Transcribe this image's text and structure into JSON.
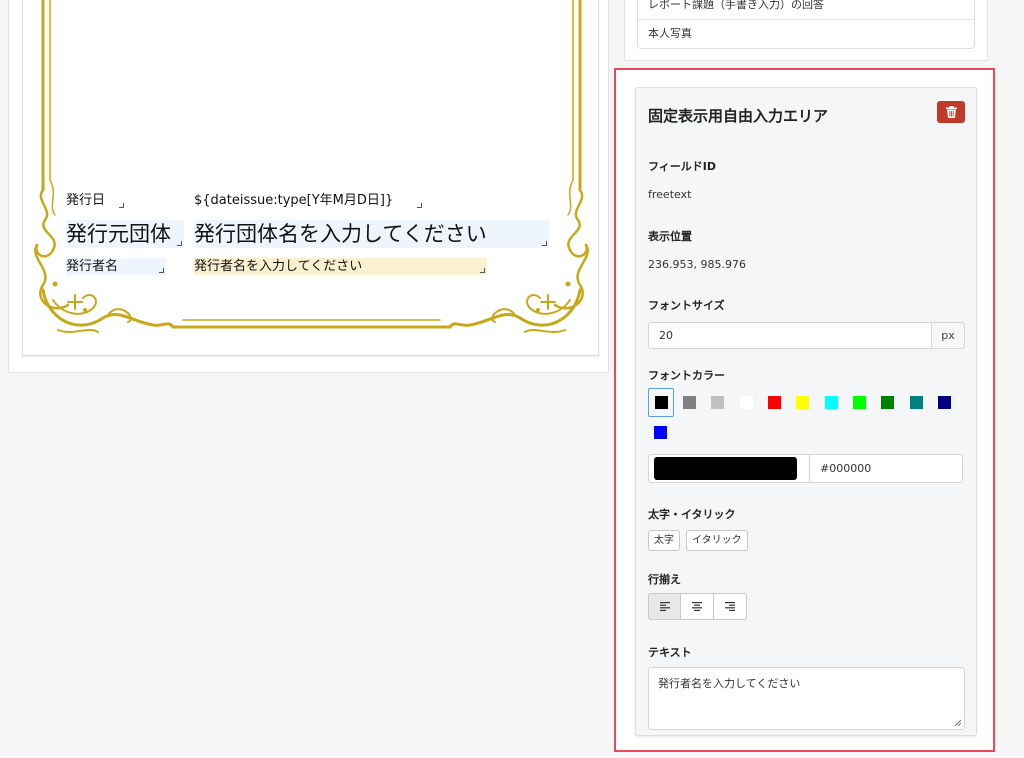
{
  "certificate": {
    "issue_date_label": "発行日",
    "issue_date_value": "${dateissue:type[Y年M月D日]}",
    "org_label": "発行元団体",
    "org_value": "発行団体名を入力してください",
    "issuer_label": "発行者名",
    "issuer_value": "発行者名を入力してください"
  },
  "field_list": {
    "items": [
      "レポート課題（手書き入力）の回答",
      "本人写真"
    ]
  },
  "panel": {
    "title": "固定表示用自由入力エリア",
    "field_id_label": "フィールドID",
    "field_id_value": "freetext",
    "position_label": "表示位置",
    "position_value": "236.953, 985.976",
    "font_size_label": "フォントサイズ",
    "font_size_value": "20",
    "font_size_unit": "px",
    "font_color_label": "フォントカラー",
    "palette": [
      "#000000",
      "#808080",
      "#c0c0c0",
      "#ffffff",
      "#ff0000",
      "#ffff00",
      "#00ffff",
      "#00ff00",
      "#008000",
      "#008080",
      "#000080",
      "#0000ff"
    ],
    "selected_color": "#000000",
    "color_hex": "#000000",
    "style_label": "太字・イタリック",
    "bold_label": "太字",
    "italic_label": "イタリック",
    "align_label": "行揃え",
    "align_selected": "left",
    "text_label": "テキスト",
    "text_value": "発行者名を入力してください"
  },
  "icons": {
    "delete": "trash-icon",
    "align_left": "align-left-icon",
    "align_center": "align-center-icon",
    "align_right": "align-right-icon"
  },
  "colors": {
    "frame_gold": "#c9a818",
    "highlight_border": "#e74a58",
    "delete_red": "#c0392b"
  }
}
